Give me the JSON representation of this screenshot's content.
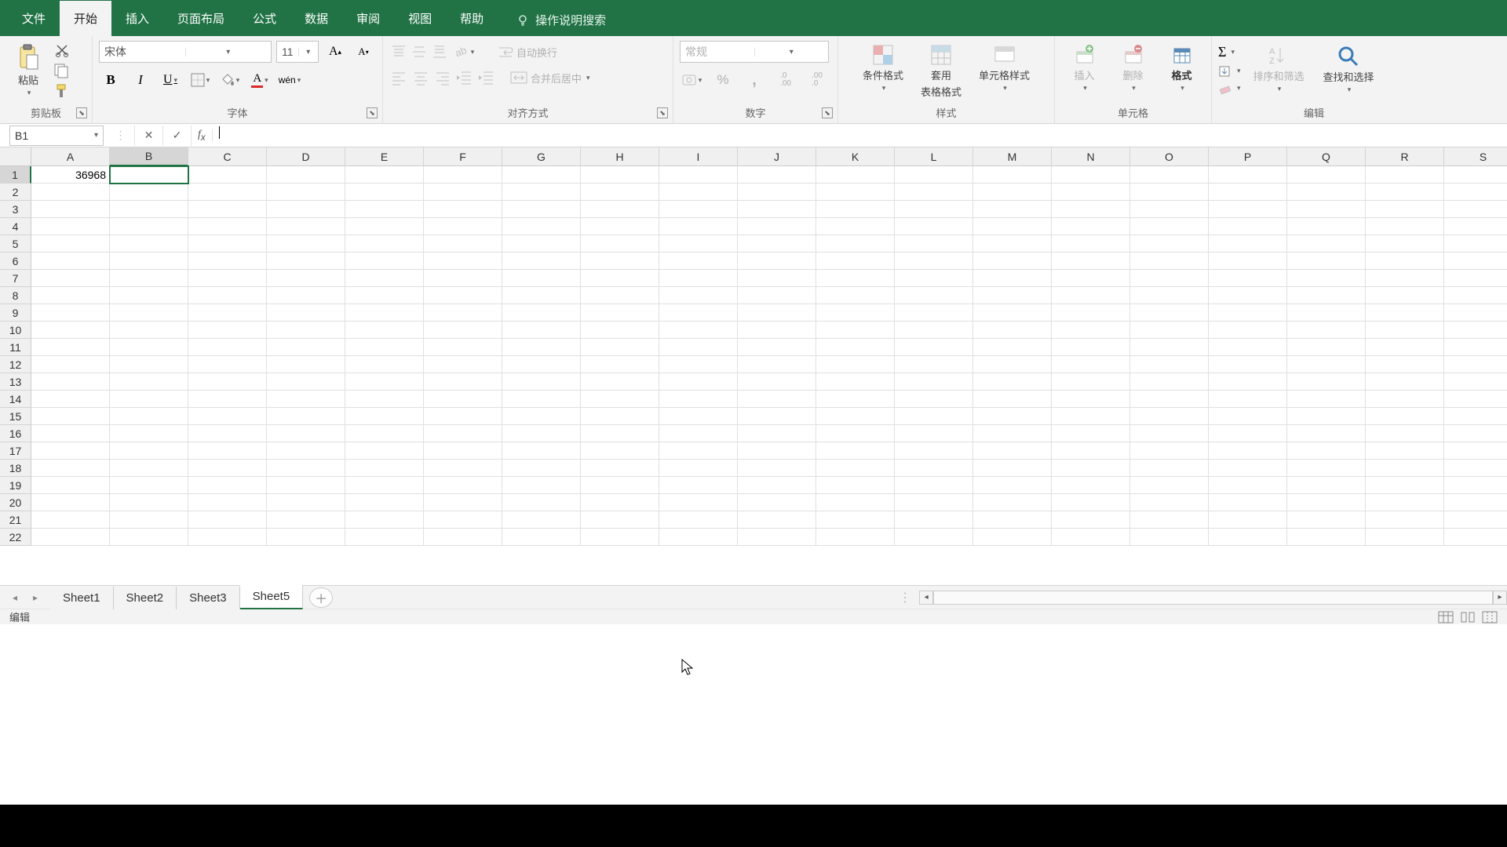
{
  "tabs": {
    "file": "文件",
    "home": "开始",
    "insert": "插入",
    "layout": "页面布局",
    "formula": "公式",
    "data": "数据",
    "review": "审阅",
    "view": "视图",
    "help": "帮助",
    "tellme": "操作说明搜索"
  },
  "ribbon": {
    "clipboard": {
      "paste": "粘贴",
      "label": "剪贴板"
    },
    "font": {
      "name": "宋体",
      "size": "11",
      "label": "字体"
    },
    "align": {
      "wrap": "自动换行",
      "merge": "合并后居中",
      "label": "对齐方式"
    },
    "number": {
      "fmt": "常规",
      "label": "数字"
    },
    "styles": {
      "cond": "条件格式",
      "tablefmt": "套用",
      "tablefmt2": "表格格式",
      "cellstyle": "单元格样式",
      "label": "样式"
    },
    "cells": {
      "insert": "插入",
      "delete": "删除",
      "format": "格式",
      "label": "单元格"
    },
    "editing": {
      "sort": "排序和筛选",
      "find": "查找和选择",
      "label": "编辑"
    }
  },
  "formula_bar": {
    "name_box": "B1",
    "fx": ""
  },
  "columns": [
    "A",
    "B",
    "C",
    "D",
    "E",
    "F",
    "G",
    "H",
    "I",
    "J",
    "K",
    "L",
    "M",
    "N",
    "O",
    "P",
    "Q",
    "R",
    "S"
  ],
  "rows": 22,
  "active": {
    "col": 1,
    "row": 0
  },
  "cells": {
    "A1": "36968"
  },
  "sheets": [
    "Sheet1",
    "Sheet2",
    "Sheet3",
    "Sheet5"
  ],
  "active_sheet": 3,
  "status": "编辑"
}
